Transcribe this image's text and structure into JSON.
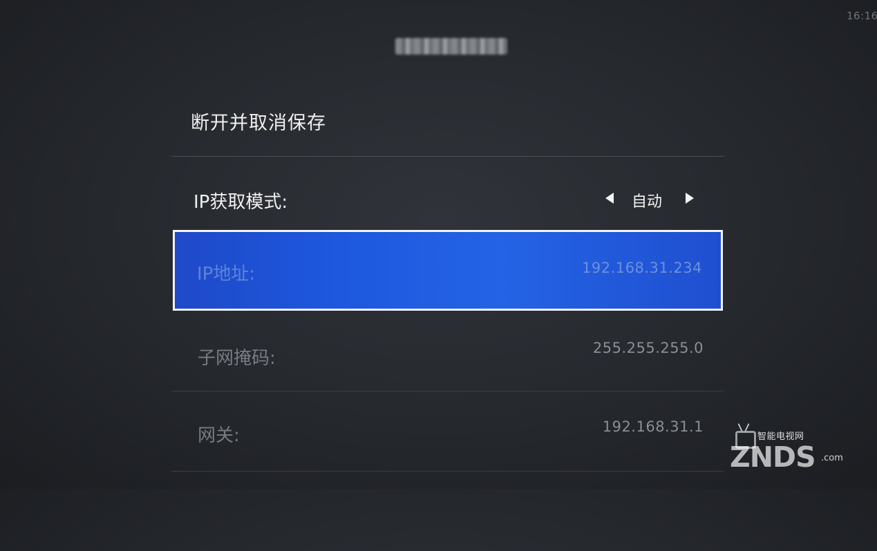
{
  "status": {
    "time": "16:16"
  },
  "header": {
    "network_name": ""
  },
  "actions": {
    "disconnect_label": "断开并取消保存"
  },
  "ip_mode": {
    "label": "IP获取模式:",
    "value": "自动"
  },
  "fields": [
    {
      "label": "IP地址:",
      "value": "192.168.31.234",
      "focused": true
    },
    {
      "label": "子网掩码:",
      "value": "255.255.255.0",
      "focused": false
    },
    {
      "label": "网关:",
      "value": "192.168.31.1",
      "focused": false
    },
    {
      "label": "",
      "value": "",
      "focused": false
    }
  ],
  "watermark": {
    "chinese": "智能电视网",
    "brand": "ZNDS",
    "domain": ".com"
  },
  "colors": {
    "background": "#25282D",
    "focus_blue": "#1F55DB",
    "focus_border": "#F4F4F4",
    "text_primary": "#F1F1EE",
    "text_muted": "#777C84"
  },
  "icons": {
    "left_arrow": "left-arrow-icon",
    "right_arrow": "right-arrow-icon",
    "watermark_tv": "tv-icon"
  }
}
